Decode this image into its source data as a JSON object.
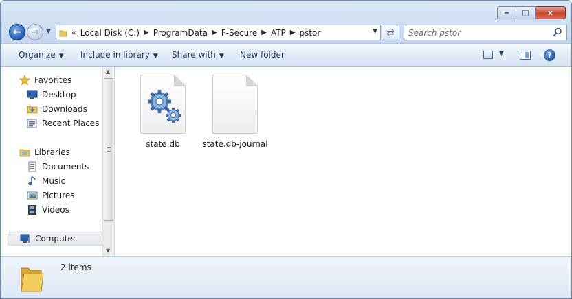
{
  "window": {
    "caption_buttons": {
      "minimize": "‒",
      "maximize": "□",
      "close": "x"
    }
  },
  "navigation": {
    "back_label": "←",
    "forward_label": "→",
    "breadcrumb_lead": "«",
    "breadcrumb": [
      "Local Disk (C:)",
      "ProgramData",
      "F-Secure",
      "ATP",
      "pstor"
    ],
    "search_placeholder": "Search pstor"
  },
  "toolbar": {
    "organize": "Organize",
    "include_in_library": "Include in library",
    "share_with": "Share with",
    "new_folder": "New folder",
    "help": "?"
  },
  "sidebar": {
    "favorites": {
      "label": "Favorites",
      "items": [
        "Desktop",
        "Downloads",
        "Recent Places"
      ]
    },
    "libraries": {
      "label": "Libraries",
      "items": [
        "Documents",
        "Music",
        "Pictures",
        "Videos"
      ]
    },
    "computer": "Computer"
  },
  "files": [
    {
      "name": "state.db",
      "icon": "settings-gears-file-icon"
    },
    {
      "name": "state.db-journal",
      "icon": "blank-file-icon"
    }
  ],
  "details": {
    "count": "2 items"
  },
  "colors": {
    "frame": "#c9d9ee",
    "accent": "#1f5bb1",
    "close_button": "#c7452c"
  }
}
